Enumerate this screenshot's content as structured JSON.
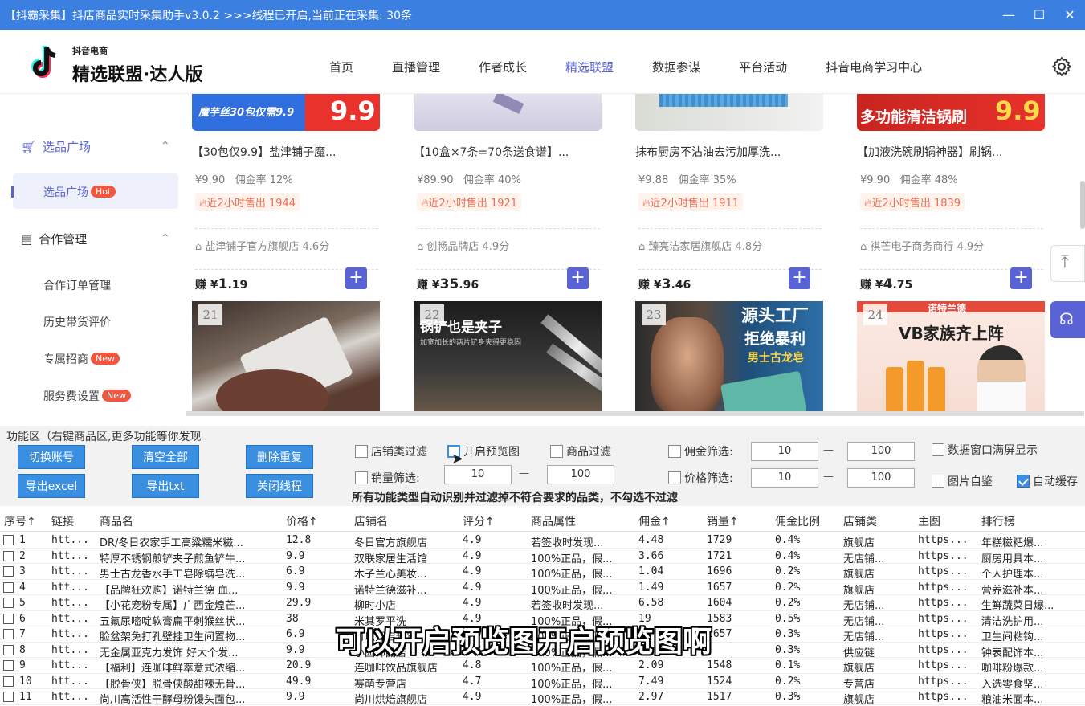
{
  "window": {
    "title": "【抖霸采集】抖店商品实时采集助手v3.0.2 >>>线程已开启,当前正在采集: 30条",
    "minimize": "—",
    "maximize": "☐",
    "close": "✕"
  },
  "brand": {
    "top": "抖音电商",
    "name": "精选联盟·达人版"
  },
  "nav": [
    "首页",
    "直播管理",
    "作者成长",
    "精选联盟",
    "数据参谋",
    "平台活动",
    "抖音电商学习中心"
  ],
  "nav_active": "精选联盟",
  "sidebar": {
    "group1": "选品广场",
    "group1_sub": {
      "label": "选品广场",
      "badge": "Hot"
    },
    "group2": "合作管理",
    "items": [
      {
        "label": "合作订单管理",
        "badge": ""
      },
      {
        "label": "历史带货评价",
        "badge": ""
      },
      {
        "label": "专属招商",
        "badge": "New"
      },
      {
        "label": "服务费设置",
        "badge": "New"
      }
    ]
  },
  "cards": [
    {
      "banner_text": "魔芋丝30包仅需9.9",
      "banner_price": "9.9",
      "title": "【30包仅9.9】盐津铺子魔...",
      "price": "¥9.90",
      "rate": "佣金率 12%",
      "sold": "近2小时售出 1944",
      "shop": "盐津铺子官方旗舰店 4.6分",
      "earn_prefix": "赚 ¥",
      "earn_int": "1",
      "earn_dec": ".19",
      "next_num": "21"
    },
    {
      "banner_text": "",
      "banner_price": "",
      "title": "【10盒×7条=70条送食谱】...",
      "price": "¥89.90",
      "rate": "佣金率 40%",
      "sold": "近2小时售出 1921",
      "shop": "创畅品牌店 4.9分",
      "earn_prefix": "赚 ¥",
      "earn_int": "35",
      "earn_dec": ".96",
      "next_num": "22"
    },
    {
      "banner_text": "",
      "banner_price": "",
      "title": "抹布厨房不沾油去污加厚洗...",
      "price": "¥9.88",
      "rate": "佣金率 35%",
      "sold": "近2小时售出 1911",
      "shop": "臻亮洁家居旗舰店 4.8分",
      "earn_prefix": "赚 ¥",
      "earn_int": "3",
      "earn_dec": ".46",
      "next_num": "23"
    },
    {
      "banner_text": "多功能清洁锅刷",
      "banner_price": "9.9",
      "title": "【加液洗碗刷锅神器】刷锅...",
      "price": "¥9.90",
      "rate": "佣金率 48%",
      "sold": "近2小时售出 1839",
      "shop": "祺芒电子商务商行 4.9分",
      "earn_prefix": "赚 ¥",
      "earn_int": "4",
      "earn_dec": ".75",
      "next_num": "24"
    }
  ],
  "thumb_texts": {
    "t22a": "锅铲也是夹子",
    "t22b": "加宽加长的两片铲身夹得更稳固",
    "t23a": "源头工厂",
    "t23b": "拒绝暴利",
    "t23c": "男士古龙皂",
    "t24a": "诺特兰德",
    "t24b": "VB家族齐上阵"
  },
  "func": {
    "legend": "功能区（右键商品区,更多功能等你发现",
    "buttons": {
      "switch": "切换账号",
      "clear": "清空全部",
      "dedupe": "删除重复",
      "export_excel": "导出excel",
      "export_txt": "导出txt",
      "close_thread": "关闭线程"
    },
    "checks": {
      "shop_filter": "店铺类过滤",
      "preview": "开启预览图",
      "goods_filter": "商品过滤",
      "comm_filter": "佣金筛选:",
      "fullscreen": "数据窗口满屏显示",
      "sales_filter": "销量筛选:",
      "price_filter": "价格筛选:",
      "img_self": "图片自鉴",
      "autosave": "自动缓存"
    },
    "values": {
      "comm_min": "10",
      "comm_max": "100",
      "sales_min": "10",
      "sales_max": "100",
      "price_min": "10",
      "price_max": "100"
    },
    "dash": "—",
    "note": "所有功能类型自动识别并过滤掉不符合要求的品类，不勾选不过滤"
  },
  "table": {
    "headers": [
      "序号↑",
      "链接",
      "商品名",
      "价格↑",
      "店铺名",
      "评分↑",
      "商品属性",
      "佣金↑",
      "销量↑",
      "佣金比例",
      "店铺类",
      "主图",
      "排行榜"
    ],
    "rows": [
      [
        "1",
        "htt...",
        "DR/冬日农家手工高粱糯米糍...",
        "12.8",
        "冬日官方旗舰店",
        "4.9",
        "若签收时发现...",
        "4.48",
        "1729",
        "0.4%",
        "旗舰店",
        "https...",
        "年糕糍粑爆..."
      ],
      [
        "2",
        "htt...",
        "特厚不锈钢煎铲夹子煎鱼铲牛...",
        "9.9",
        "双联家居生活馆",
        "4.9",
        "100%正品，假...",
        "3.66",
        "1721",
        "0.4%",
        "无店铺...",
        "https...",
        "厨房用具本..."
      ],
      [
        "3",
        "htt...",
        "男士古龙香水手工皂除螨皂洗...",
        "6.9",
        "木子兰心美妆...",
        "4.9",
        "100%正品，假...",
        "1.04",
        "1696",
        "0.2%",
        "旗舰店",
        "https...",
        "个人护理本..."
      ],
      [
        "4",
        "htt...",
        "【品牌狂欢购】诺特兰德 血...",
        "9.9",
        "诺特兰德滋补...",
        "4.9",
        "100%正品，假...",
        "1.49",
        "1657",
        "0.2%",
        "旗舰店",
        "https...",
        "营养滋补本..."
      ],
      [
        "5",
        "htt...",
        "【小花宠粉专属】广西金煌芒...",
        "29.9",
        "柳时小店",
        "4.9",
        "若签收时发现...",
        "6.58",
        "1604",
        "0.2%",
        "无店铺...",
        "https...",
        "生鲜蔬菜日爆..."
      ],
      [
        "6",
        "htt...",
        "五氟尿嘧啶软膏扁平刺猴丝状...",
        "38",
        "米其罗平洗",
        "4.9",
        "100%正品，假...",
        "19",
        "1583",
        "0.5%",
        "无店铺...",
        "https...",
        "清洁洗护用..."
      ],
      [
        "7",
        "htt...",
        "脸盆架免打孔壁挂卫生间置物...",
        "6.9",
        "可以开启预览",
        "4.9",
        "100%正品，假...",
        "",
        "1657",
        "0.3%",
        "无店铺...",
        "https...",
        "卫生间粘钩..."
      ],
      [
        "8",
        "htt...",
        "无金属亚克力发饰 好大个发...",
        "9.9",
        "小园饰品店",
        "4.8",
        "100%正品，假...",
        "",
        "",
        "0.3%",
        "供应链",
        "https...",
        "钟表配饰本..."
      ],
      [
        "9",
        "htt...",
        "【福利】连咖啡鲜萃意式浓缩...",
        "20.9",
        "连咖啡饮品旗舰店",
        "4.8",
        "100%正品，假...",
        "2.09",
        "1548",
        "0.1%",
        "旗舰店",
        "https...",
        "咖啡粉爆款..."
      ],
      [
        "10",
        "htt...",
        "【脱骨侠】脱骨侠酸甜辣无骨...",
        "49.9",
        "赛萌专营店",
        "4.7",
        "100%正品，假...",
        "7.49",
        "1524",
        "0.2%",
        "专营店",
        "https...",
        "入选零食坚..."
      ],
      [
        "11",
        "htt...",
        "尚川高活性干酵母粉馒头面包...",
        "9.9",
        "尚川烘焙旗舰店",
        "4.9",
        "100%正品，假...",
        "2.97",
        "1517",
        "0.3%",
        "旗舰店",
        "https...",
        "粮油米面本..."
      ]
    ]
  },
  "subtitle": "可以开启预览图开启预览图啊",
  "colors": {
    "accent": "#5a63d6",
    "titlebar": "#3b7fe0",
    "button": "#3b8fe0",
    "hot": "#f4553d"
  }
}
